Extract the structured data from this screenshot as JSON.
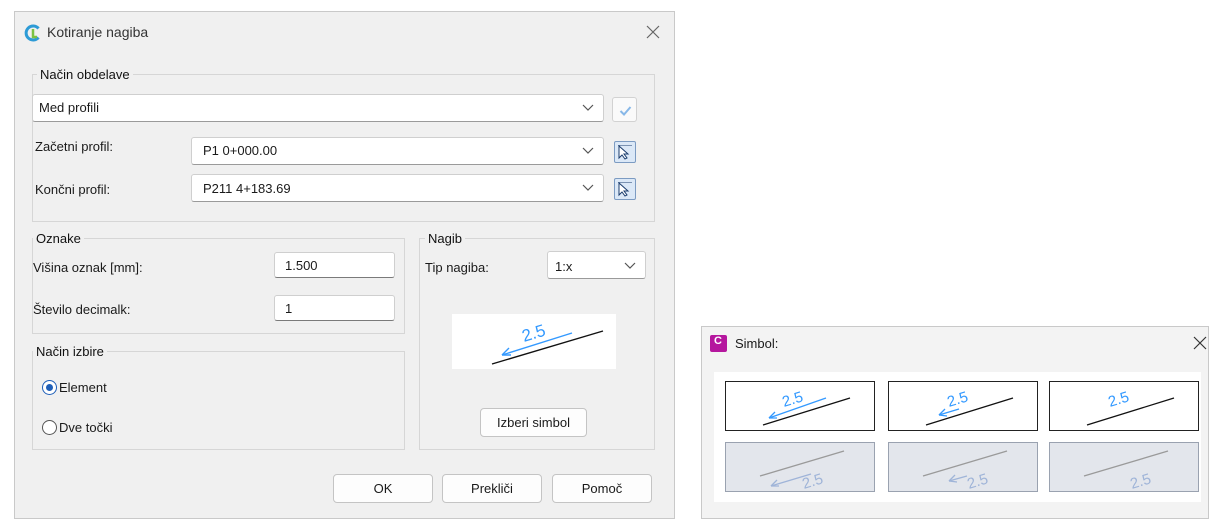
{
  "dialog": {
    "title": "Kotiranje nagiba",
    "nacin_obdelave": {
      "legend": "Način obdelave",
      "mode_value": "Med profili",
      "start_label": "Začetni profil:",
      "start_value": "P1 0+000.00",
      "end_label": "Končni profil:",
      "end_value": "P211 4+183.69"
    },
    "oznake": {
      "legend": "Oznake",
      "height_label": "Višina oznak [mm]:",
      "height_value": "1.500",
      "decimals_label": "Število decimalk:",
      "decimals_value": "1"
    },
    "nacin_izbire": {
      "legend": "Način izbire",
      "opt_element": "Element",
      "opt_two_points": "Dve točki",
      "selected": "Element"
    },
    "nagib": {
      "legend": "Nagib",
      "type_label": "Tip nagiba:",
      "type_value": "1:x",
      "preview_label": "2.5",
      "choose_symbol": "Izberi simbol"
    },
    "buttons": {
      "ok": "OK",
      "cancel": "Prekliči",
      "help": "Pomoč"
    }
  },
  "symbol_window": {
    "title": "Simbol:",
    "tiles": [
      "2.5",
      "2.5",
      "2.5",
      "2.5",
      "2.5",
      "2.5"
    ]
  },
  "colors": {
    "accent_blue": "#3399ff",
    "radio_blue": "#1f5fb8",
    "app_icon": "#b5179e"
  }
}
